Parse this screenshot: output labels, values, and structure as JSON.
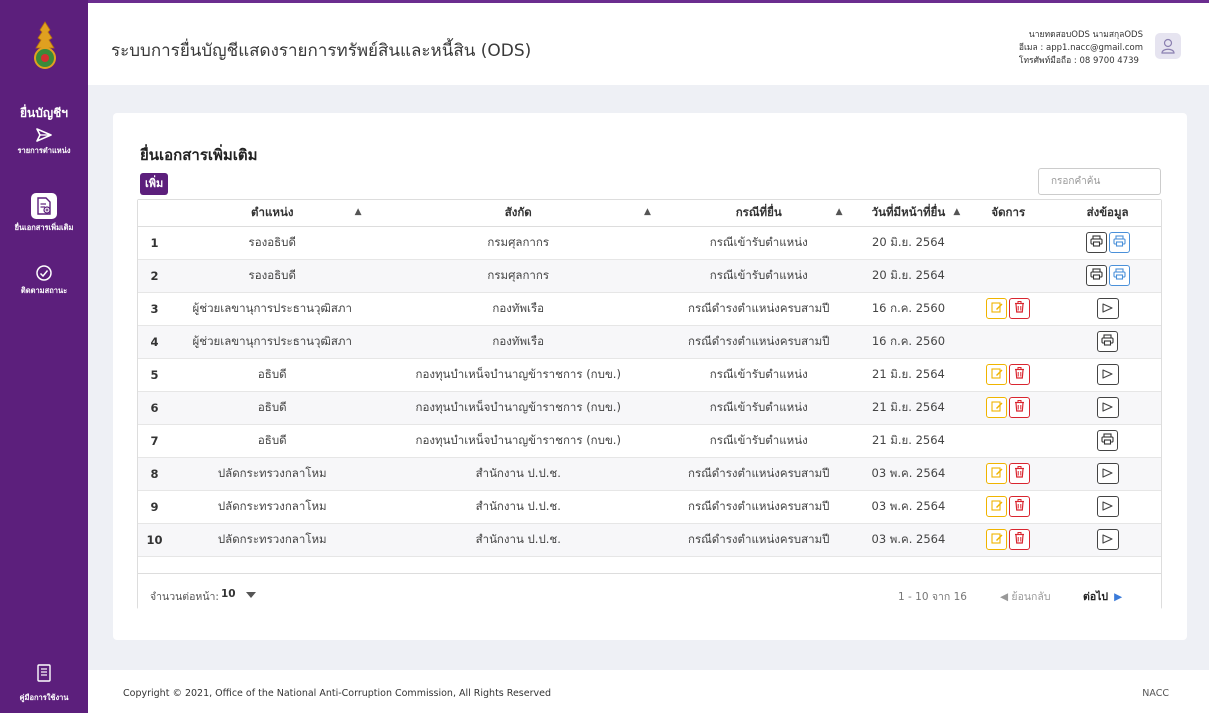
{
  "app": {
    "title": "ระบบการยื่นบัญชีแสดงรายการทรัพย์สินและหนี้สิน (ODS)"
  },
  "user": {
    "name": "นายทดสอบODS นามสกุลODS",
    "email": "อีเมล : app1.nacc@gmail.com",
    "phone": "โทรศัพท์มือถือ : 08 9700 4739"
  },
  "sidebar": {
    "section_title": "ยื่นบัญชีฯ",
    "items": [
      {
        "label": "รายการตำแหน่ง",
        "icon": "send-arrow-icon"
      },
      {
        "label": "ยื่นเอกสารเพิ่มเติม",
        "icon": "document-add-icon"
      },
      {
        "label": "ติดตามสถานะ",
        "icon": "track-status-icon"
      }
    ],
    "manual_label": "คู่มือการใช้งาน"
  },
  "page": {
    "title": "ยื่นเอกสารเพิ่มเติม",
    "add_button": "เพิ่ม",
    "search_placeholder": "กรอกคำค้น"
  },
  "table": {
    "headers": [
      "",
      "ตำแหน่ง",
      "สังกัด",
      "กรณีที่ยื่น",
      "วันที่มีหน้าที่ยื่น",
      "จัดการ",
      "ส่งข้อมูล"
    ],
    "rows": [
      {
        "no": "1",
        "position": "รองอธิบดี",
        "dept": "กรมศุลกากร",
        "case": "กรณีเข้ารับตำแหน่ง",
        "date": "20 มิ.ย. 2564",
        "manage": false,
        "send": "print-pair"
      },
      {
        "no": "2",
        "position": "รองอธิบดี",
        "dept": "กรมศุลกากร",
        "case": "กรณีเข้ารับตำแหน่ง",
        "date": "20 มิ.ย. 2564",
        "manage": false,
        "send": "print-pair"
      },
      {
        "no": "3",
        "position": "ผู้ช่วยเลขานุการประธานวุฒิสภา",
        "dept": "กองทัพเรือ",
        "case": "กรณีดำรงตำแหน่งครบสามปี",
        "date": "16 ก.ค. 2560",
        "manage": true,
        "send": "send"
      },
      {
        "no": "4",
        "position": "ผู้ช่วยเลขานุการประธานวุฒิสภา",
        "dept": "กองทัพเรือ",
        "case": "กรณีดำรงตำแหน่งครบสามปี",
        "date": "16 ก.ค. 2560",
        "manage": false,
        "send": "print"
      },
      {
        "no": "5",
        "position": "อธิบดี",
        "dept": "กองทุนบำเหน็จบำนาญข้าราชการ (กบข.)",
        "case": "กรณีเข้ารับตำแหน่ง",
        "date": "21 มิ.ย. 2564",
        "manage": true,
        "send": "send"
      },
      {
        "no": "6",
        "position": "อธิบดี",
        "dept": "กองทุนบำเหน็จบำนาญข้าราชการ (กบข.)",
        "case": "กรณีเข้ารับตำแหน่ง",
        "date": "21 มิ.ย. 2564",
        "manage": true,
        "send": "send"
      },
      {
        "no": "7",
        "position": "อธิบดี",
        "dept": "กองทุนบำเหน็จบำนาญข้าราชการ (กบข.)",
        "case": "กรณีเข้ารับตำแหน่ง",
        "date": "21 มิ.ย. 2564",
        "manage": false,
        "send": "print"
      },
      {
        "no": "8",
        "position": "ปลัดกระทรวงกลาโหม",
        "dept": "สำนักงาน ป.ป.ช.",
        "case": "กรณีดำรงตำแหน่งครบสามปี",
        "date": "03 พ.ค. 2564",
        "manage": true,
        "send": "send"
      },
      {
        "no": "9",
        "position": "ปลัดกระทรวงกลาโหม",
        "dept": "สำนักงาน ป.ป.ช.",
        "case": "กรณีดำรงตำแหน่งครบสามปี",
        "date": "03 พ.ค. 2564",
        "manage": true,
        "send": "send"
      },
      {
        "no": "10",
        "position": "ปลัดกระทรวงกลาโหม",
        "dept": "สำนักงาน ป.ป.ช.",
        "case": "กรณีดำรงตำแหน่งครบสามปี",
        "date": "03 พ.ค. 2564",
        "manage": true,
        "send": "send"
      }
    ]
  },
  "pager": {
    "per_page_label": "จำนวนต่อหน้า:",
    "per_page_value": "10",
    "range": "1 - 10 จาก 16",
    "prev": "◀ ย้อนกลับ",
    "next": "ต่อไป"
  },
  "footer": {
    "copyright": "Copyright © 2021, Office of the National Anti-Corruption Commission, All Rights Reserved",
    "org": "NACC"
  },
  "colors": {
    "brand": "#5c1f7c",
    "edit": "#f0b400",
    "delete": "#d9252f",
    "print_alt": "#4a90d9"
  }
}
